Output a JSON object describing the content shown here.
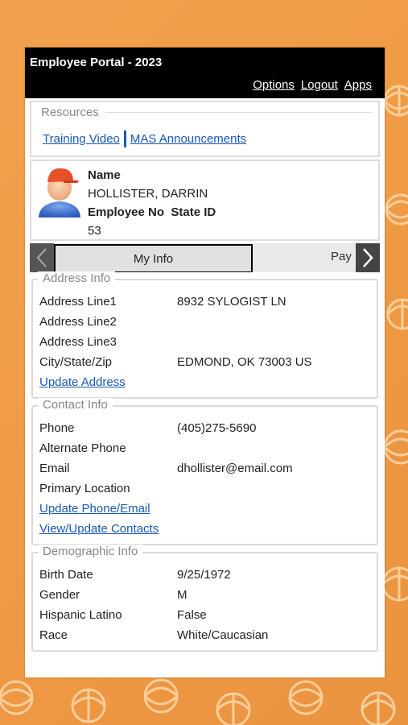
{
  "header": {
    "title": "Employee Portal - 2023",
    "links": [
      "Options",
      "Logout",
      "Apps"
    ]
  },
  "resources": {
    "legend": "Resources",
    "links": [
      "Training Video",
      "MAS Announcements"
    ]
  },
  "profile": {
    "name_label": "Name",
    "name": "HOLLISTER, DARRIN",
    "employee_no_label": "Employee No",
    "state_id_label": "State ID",
    "employee_no": "53"
  },
  "tabs": {
    "active": "My Info",
    "next": "Pay"
  },
  "address": {
    "legend": "Address Info",
    "rows": [
      {
        "label": "Address Line1",
        "value": "8932 SYLOGIST LN"
      },
      {
        "label": "Address Line2",
        "value": ""
      },
      {
        "label": "Address Line3",
        "value": ""
      },
      {
        "label": "City/State/Zip",
        "value": "EDMOND, OK 73003 US"
      }
    ],
    "update_link": "Update Address"
  },
  "contact": {
    "legend": "Contact Info",
    "rows": [
      {
        "label": "Phone",
        "value": "(405)275-5690"
      },
      {
        "label": "Alternate Phone",
        "value": ""
      },
      {
        "label": "Email",
        "value": "dhollister@email.com"
      },
      {
        "label": "Primary Location",
        "value": ""
      }
    ],
    "links": [
      "Update Phone/Email",
      "View/Update Contacts"
    ]
  },
  "demographic": {
    "legend": "Demographic Info",
    "rows": [
      {
        "label": "Birth Date",
        "value": "9/25/1972"
      },
      {
        "label": "Gender",
        "value": "M"
      },
      {
        "label": "Hispanic Latino",
        "value": "False"
      },
      {
        "label": "Race",
        "value": "White/Caucasian"
      }
    ]
  },
  "colors": {
    "accent": "#1a57b5",
    "background": "#f0a04d",
    "header": "#000000"
  }
}
